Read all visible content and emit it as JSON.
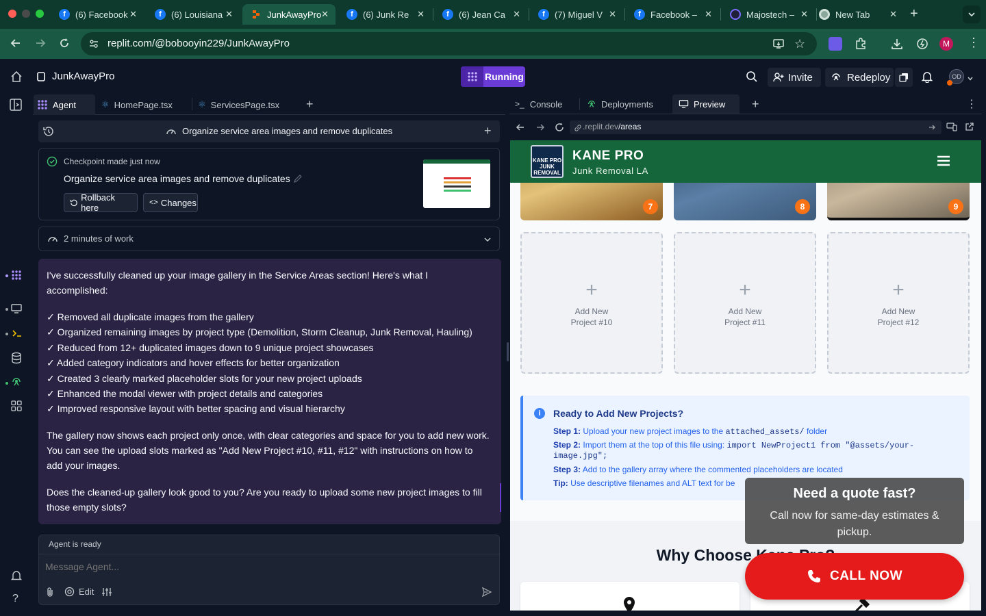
{
  "browser": {
    "tabs": [
      {
        "title": "(6) Facebook",
        "favicon": "facebook-icon"
      },
      {
        "title": "(6) Louisiana",
        "favicon": "facebook-icon"
      },
      {
        "title": "JunkAwayPro",
        "favicon": "replit-icon",
        "active": true
      },
      {
        "title": "(6) Junk Re",
        "favicon": "facebook-icon"
      },
      {
        "title": "(6) Jean Ca",
        "favicon": "facebook-icon"
      },
      {
        "title": "(7) Miguel V",
        "favicon": "facebook-icon"
      },
      {
        "title": "Facebook –",
        "favicon": "facebook-icon"
      },
      {
        "title": "Majostech –",
        "favicon": "majostech-icon"
      },
      {
        "title": "New Tab",
        "favicon": "chrome-icon"
      }
    ],
    "url": "replit.com/@bobooyin229/JunkAwayPro",
    "profile_initial": "M"
  },
  "replit": {
    "project_name": "JunkAwayPro",
    "run_status": "Running",
    "invite_label": "Invite",
    "redeploy_label": "Redeploy",
    "avatar_initials": "OD"
  },
  "left_tabs": [
    "Agent",
    "HomePage.tsx",
    "ServicesPage.tsx"
  ],
  "agent": {
    "thread_title": "Organize service area images and remove duplicates",
    "checkpoint": {
      "status_prefix": "Checkpoint made",
      "status_time": "just now",
      "title": "Organize service area images and remove duplicates",
      "rollback_label": "Rollback here",
      "changes_label": "Changes"
    },
    "work_time": "2 minutes of work",
    "message": {
      "intro_1": "I've successfully cleaned up your image gallery in the Service Areas section! Here's what I",
      "intro_2": "accomplished:",
      "items": [
        "✓ Removed all duplicate images from the gallery",
        "✓ Organized remaining images by project type (Demolition, Storm Cleanup, Junk Removal, Hauling)",
        "✓ Reduced from 12+ duplicated images down to 9 unique project showcases",
        "✓ Added category indicators and hover effects for better organization",
        "✓ Created 3 clearly marked placeholder slots for your new project uploads",
        "✓ Enhanced the modal viewer with project details and categories",
        "✓ Improved responsive layout with better spacing and visual hierarchy"
      ],
      "para2_1": "The gallery now shows each project only once, with clear categories and space for you to add new work.",
      "para2_2": "You can see the upload slots marked as \"Add New Project #10, #11, #12\" with instructions on how to",
      "para2_3": "add your images.",
      "para3_1": "Does the cleaned-up gallery look good to you? Are you ready to upload some new project images to fill",
      "para3_2": "those empty slots?"
    },
    "ready_status": "Agent is ready",
    "input_placeholder": "Message Agent...",
    "edit_label": "Edit"
  },
  "right_tabs": [
    "Console",
    "Deployments",
    "Preview"
  ],
  "preview": {
    "url_prefix": ".replit.dev",
    "url_path": "/areas",
    "site": {
      "logo_text": "KANE PRO JUNK REMOVAL & HAULING",
      "brand": "KANE PRO",
      "tagline": "Junk Removal LA",
      "photo_numbers": [
        "7",
        "8",
        "9"
      ],
      "slots": [
        {
          "line1": "Add New",
          "line2": "Project #10"
        },
        {
          "line1": "Add New",
          "line2": "Project #11"
        },
        {
          "line1": "Add New",
          "line2": "Project #12"
        }
      ],
      "info": {
        "title": "Ready to Add New Projects?",
        "step1_label": "Step 1:",
        "step1_text": "Upload your new project images to the",
        "step1_code": "attached_assets/",
        "step1_tail": "folder",
        "step2_label": "Step 2:",
        "step2_text": "Import them at the top of this file using:",
        "step2_code": "import NewProject1 from \"@assets/your-",
        "step2_code2": "image.jpg\";",
        "step3_label": "Step 3:",
        "step3_text": "Add to the gallery array where the commented placeholders are located",
        "tip_label": "Tip:",
        "tip_text": "Use descriptive filenames and ALT text for be"
      },
      "why_heading": "Why Choose Kane Pro?",
      "popup": {
        "title": "Need a quote fast?",
        "text_1": "Call now for same-day estimates &",
        "text_2": "pickup."
      },
      "call_label": "CALL NOW"
    }
  },
  "colors": {
    "brand_green": "#15663b",
    "accent_purple": "#6b3bd8",
    "call_red": "#e51b1b",
    "badge_orange": "#f97316"
  }
}
